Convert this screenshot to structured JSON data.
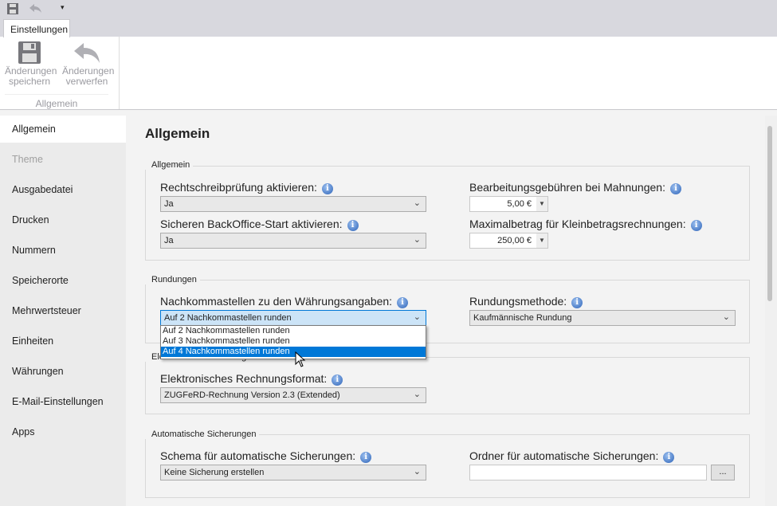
{
  "qat": {
    "icons": [
      "save-icon",
      "undo-icon",
      "customize-icon"
    ]
  },
  "ribbon": {
    "tab": "Einstellungen",
    "save": "Änderungen speichern",
    "save_l1": "Änderungen",
    "save_l2": "speichern",
    "discard_l1": "Änderungen",
    "discard_l2": "verwerfen",
    "group": "Allgemein"
  },
  "sidebar": {
    "items": [
      {
        "label": "Allgemein",
        "selected": true
      },
      {
        "label": "Theme",
        "disabled": true
      },
      {
        "label": "Ausgabedatei"
      },
      {
        "label": "Drucken"
      },
      {
        "label": "Nummern"
      },
      {
        "label": "Speicherorte"
      },
      {
        "label": "Mehrwertsteuer"
      },
      {
        "label": "Einheiten"
      },
      {
        "label": "Währungen"
      },
      {
        "label": "E-Mail-Einstellungen"
      },
      {
        "label": "Apps"
      }
    ]
  },
  "main": {
    "title": "Allgemein",
    "allgemein": {
      "label": "Allgemein",
      "spell_label": "Rechtschreibprüfung aktivieren:",
      "spell_value": "Ja",
      "backoffice_label": "Sicheren BackOffice-Start aktivieren:",
      "backoffice_value": "Ja",
      "fees_label": "Bearbeitungsgebühren bei Mahnungen:",
      "fees_value": "5,00 €",
      "max_label": "Maximalbetrag für Kleinbetragsrechnungen:",
      "max_value": "250,00 €"
    },
    "rundungen": {
      "label": "Rundungen",
      "decimals_label": "Nachkommastellen zu den Währungsangaben:",
      "decimals_value": "Auf 2 Nachkommastellen runden",
      "options": [
        "Auf 2 Nachkommastellen runden",
        "Auf 3 Nachkommastellen runden",
        "Auf 4 Nachkommastellen runden"
      ],
      "highlighted": 2,
      "method_label": "Rundungsmethode:",
      "method_value": "Kaufmännische Rundung"
    },
    "erechnung": {
      "label": "Elektronische Rechnungen",
      "format_label": "Elektronisches Rechnungsformat:",
      "format_value": "ZUGFeRD-Rechnung Version 2.3 (Extended)"
    },
    "backup": {
      "label": "Automatische Sicherungen",
      "schema_label": "Schema für automatische Sicherungen:",
      "schema_value": "Keine Sicherung erstellen",
      "folder_label": "Ordner für automatische Sicherungen:",
      "folder_value": "",
      "browse": "..."
    }
  },
  "colors": {
    "accent": "#0078d7",
    "sidebar": "#ebebeb",
    "content": "#f3f3f3"
  }
}
